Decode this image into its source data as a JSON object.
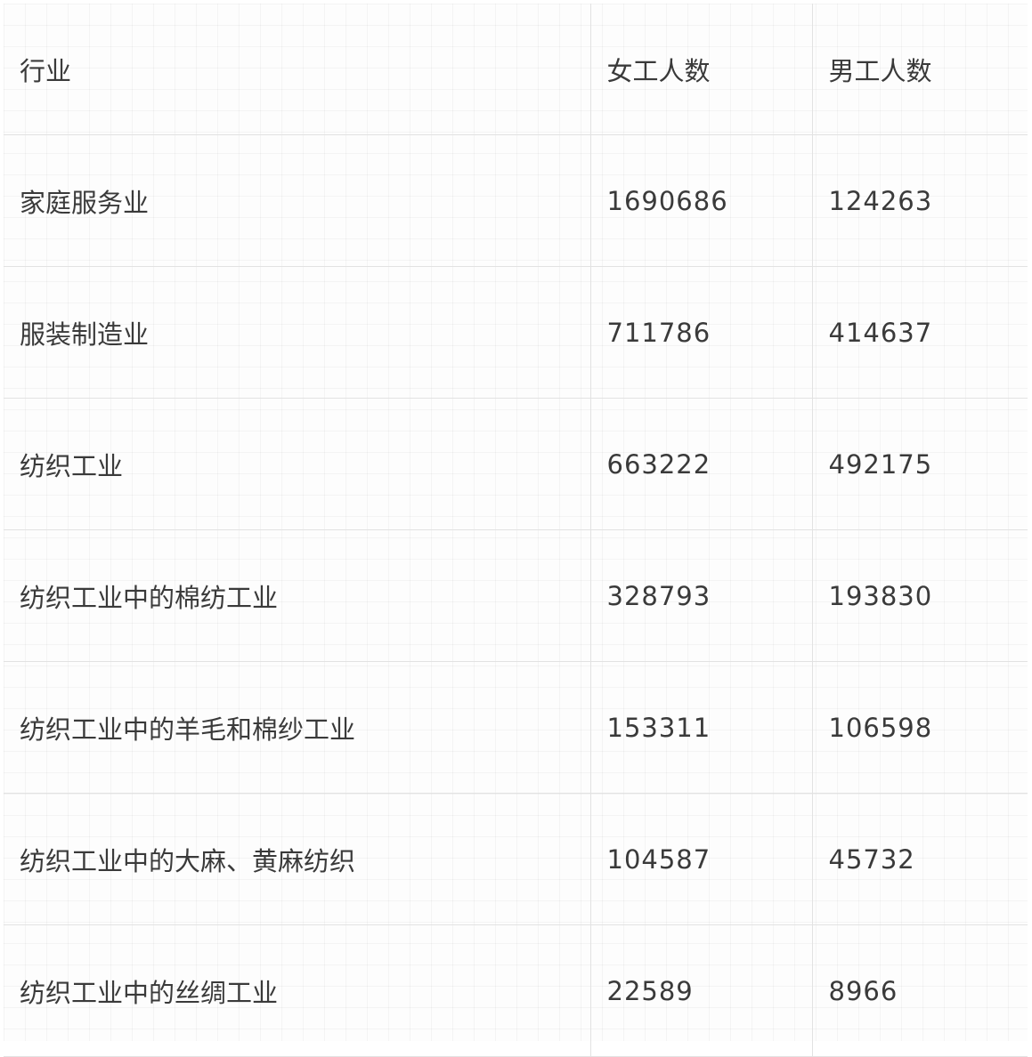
{
  "table": {
    "headers": {
      "industry": "行业",
      "female": "女工人数",
      "male": "男工人数"
    },
    "rows": [
      {
        "industry": "家庭服务业",
        "female": "1690686",
        "male": "124263"
      },
      {
        "industry": "服装制造业",
        "female": "711786",
        "male": "414637"
      },
      {
        "industry": "纺织工业",
        "female": "663222",
        "male": "492175"
      },
      {
        "industry": "纺织工业中的棉纺工业",
        "female": "328793",
        "male": "193830"
      },
      {
        "industry": "纺织工业中的羊毛和棉纱工业",
        "female": "153311",
        "male": "106598"
      },
      {
        "industry": "纺织工业中的大麻、黄麻纺织",
        "female": "104587",
        "male": "45732"
      },
      {
        "industry": "纺织工业中的丝绸工业",
        "female": "22589",
        "male": "8966"
      }
    ]
  }
}
